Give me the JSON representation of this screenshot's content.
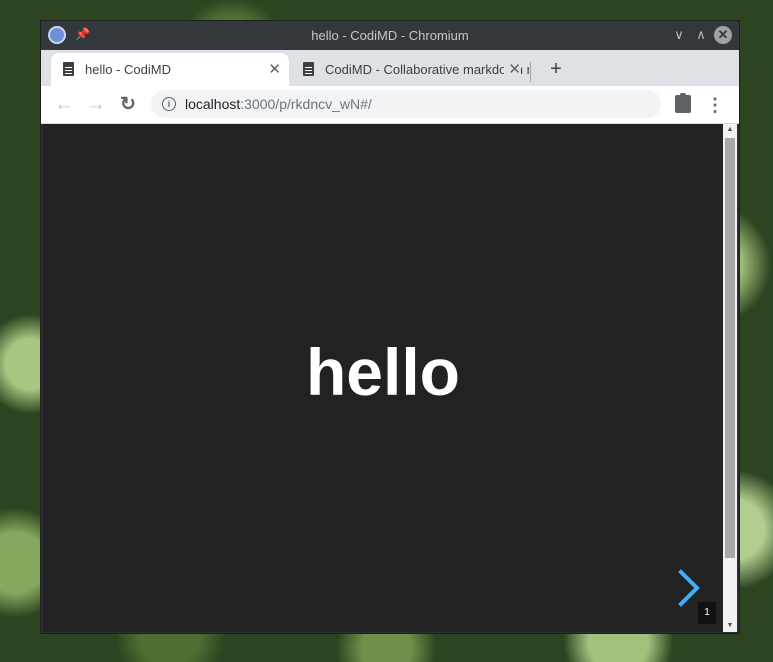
{
  "window": {
    "title": "hello - CodiMD - Chromium",
    "controls": {
      "minimize": "∨",
      "maximize": "∧",
      "close": "✕"
    }
  },
  "tabs": [
    {
      "label": "hello - CodiMD",
      "active": true,
      "close": "✕"
    },
    {
      "label": "CodiMD - Collaborative markdown notes",
      "active": false,
      "close": "✕"
    }
  ],
  "new_tab": "+",
  "toolbar": {
    "back": "←",
    "forward": "→",
    "reload": "↻",
    "url_host": "localhost",
    "url_path": ":3000/p/rkdncv_wN#/",
    "info": "i",
    "menu": "⋮"
  },
  "slide": {
    "text": "hello",
    "slide_number": "1",
    "arrow_color": "#42affa"
  },
  "scrollbar": {
    "up": "▲",
    "down": "▼"
  }
}
